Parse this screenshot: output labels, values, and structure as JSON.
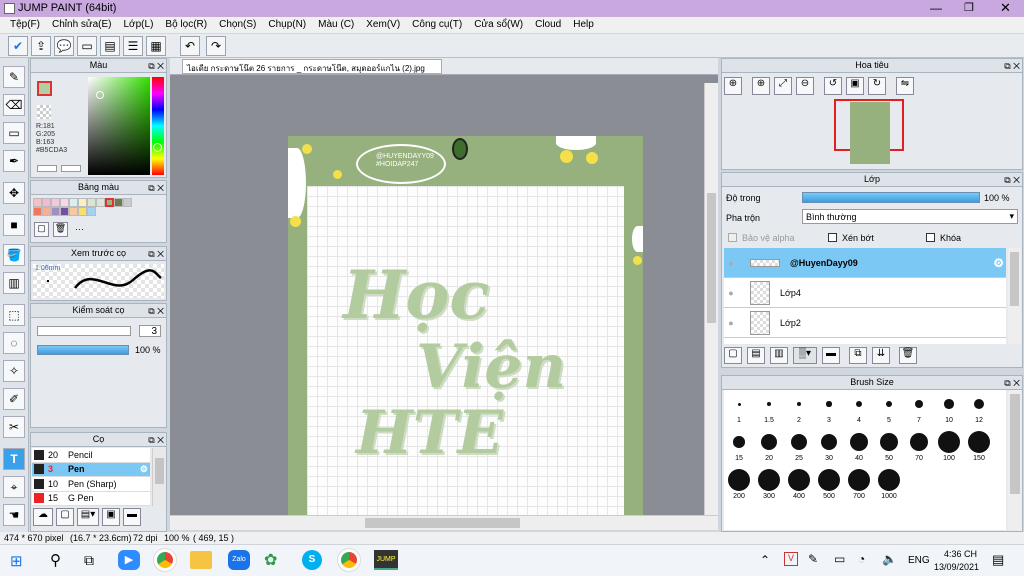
{
  "title": "JUMP PAINT (64bit)",
  "menu": [
    "Tệp(F)",
    "Chỉnh sửa(E)",
    "Lớp(L)",
    "Bộ lọc(R)",
    "Chọn(S)",
    "Chụp(N)",
    "Màu (C)",
    "Xem(V)",
    "Công cụ(T)",
    "Cửa sổ(W)",
    "Cloud",
    "Help"
  ],
  "color_panel": {
    "title": "Màu",
    "r": "R:181",
    "g": "G:205",
    "b": "B:163",
    "hex": "#B5CDA3",
    "primary": "#b5cda3"
  },
  "palette_title": "Bảng màu",
  "brush_preview": {
    "title": "Xem trước cọ",
    "size": "1.06mm"
  },
  "brush_control": {
    "title": "Kiểm soát cọ",
    "size": "3",
    "opacity": "100 %"
  },
  "brush_panel": {
    "title": "Cọ",
    "items": [
      {
        "size": "20",
        "name": "Pencil"
      },
      {
        "size": "3",
        "name": "Pen"
      },
      {
        "size": "10",
        "name": "Pen (Sharp)"
      },
      {
        "size": "15",
        "name": "G Pen"
      }
    ]
  },
  "document_tab": "ไอเดีย กระดาษโน๊ต 26 รายการ _ กระดาษโน๊ต, สมุดออร์แกไน (2).jpg",
  "canvas_text": {
    "handle1": "@HUYENDAYY09",
    "handle2": "#HOIDAP247",
    "line1": "Học",
    "line2": "Viện",
    "line3": "HTE"
  },
  "navigator_title": "Hoa tiêu",
  "layer_panel": {
    "title": "Lớp",
    "opacity_label": "Độ trong",
    "opacity_value": "100 %",
    "blend_label": "Pha trộn",
    "blend_value": "Bình thường",
    "protect_alpha": "Bảo vệ alpha",
    "clip": "Xén bớt",
    "lock": "Khóa",
    "layers": [
      "@HuyenDayy09",
      "Lớp4",
      "Lớp2"
    ]
  },
  "brush_size": {
    "title": "Brush Size",
    "sizes": [
      "1",
      "1.5",
      "2",
      "3",
      "4",
      "5",
      "7",
      "10",
      "12",
      "15",
      "20",
      "25",
      "30",
      "40",
      "50",
      "70",
      "100",
      "150",
      "200",
      "300",
      "400",
      "500",
      "700",
      "1000"
    ]
  },
  "status": {
    "dims": "474 * 670 pixel",
    "mm": "(16.7 * 23.6cm)",
    "dpi": "72 dpi",
    "zoom": "100 %",
    "coords": "( 469, 15 )"
  },
  "taskbar": {
    "lang": "ENG",
    "time": "4:36 CH",
    "date": "13/09/2021"
  }
}
